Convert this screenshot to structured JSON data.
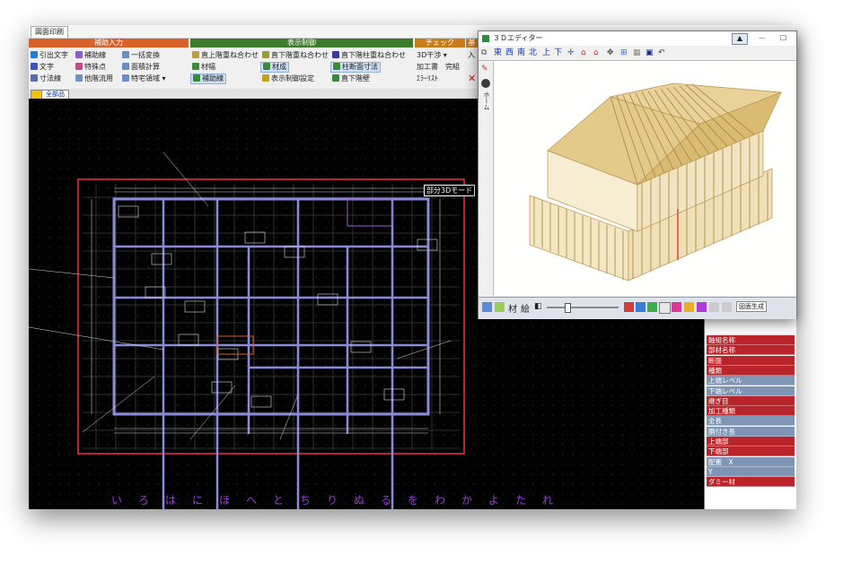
{
  "main": {
    "menu_tab": "図面印刷",
    "groups": [
      {
        "label": "補助入力",
        "color": "#d9622b"
      },
      {
        "label": "表示制御",
        "color": "#3d7c2d"
      },
      {
        "label": "チェック",
        "color": "#c97d1a"
      },
      {
        "label": "基",
        "color": "#c97d1a"
      }
    ],
    "ribbon": {
      "hikidashi": "引出文字",
      "hojosen": "補助線",
      "ikkatsu": "一括変換",
      "moji": "文字",
      "tokuten": "特殊点",
      "menseki": "面積計算",
      "sunpo": "寸法線",
      "kaisou": "他階流用",
      "tokuchi": "特宅領域",
      "ue_kasane": "直上階重ね合わせ",
      "shita_kasane": "直下階重ね合わせ",
      "shita_hashira": "直下階柱重ね合わせ",
      "zaihaba": "材幅",
      "zaimei": "材成",
      "hashira_sunpo": "柱断面寸法",
      "hojo": "補助線",
      "hyouji": "表示制御設定",
      "shita_kabe": "直下階壁",
      "btn_3d": "3D干渉",
      "kakou": "加工書",
      "kanryo": "完組",
      "error": "ｴﾗｰﾘｽﾄ",
      "iri": "入"
    },
    "tabs2": [
      "",
      "全部品"
    ],
    "canvas_labels": {
      "partial3d": "部分3Dモード"
    },
    "kana_row": [
      "い",
      "ろ",
      "は",
      "に",
      "ほ",
      "へ",
      "と",
      "ち",
      "り",
      "ぬ",
      "る",
      "を",
      "わ",
      "か",
      "よ",
      "た",
      "れ"
    ]
  },
  "properties": [
    {
      "label": "軸組名称",
      "color": "#b8242a"
    },
    {
      "label": "部材名称",
      "color": "#b8242a"
    },
    {
      "label": "断面",
      "color": "#b8242a"
    },
    {
      "label": "種類",
      "color": "#b8242a"
    },
    {
      "label": "上端レベル",
      "color": "#7f95b6"
    },
    {
      "label": "下端レベル",
      "color": "#7f95b6"
    },
    {
      "label": "継ぎ目",
      "color": "#b8242a"
    },
    {
      "label": "加工種類",
      "color": "#b8242a"
    },
    {
      "label": "全長",
      "color": "#7f95b6"
    },
    {
      "label": "胴付き長",
      "color": "#7f95b6"
    },
    {
      "label": "上端部",
      "color": "#b8242a"
    },
    {
      "label": "下端部",
      "color": "#b8242a"
    },
    {
      "label": "配置　X",
      "color": "#7f95b6"
    },
    {
      "label": "Y",
      "color": "#7f95b6"
    },
    {
      "label": "ダミー材",
      "color": "#b8242a"
    }
  ],
  "editor3d": {
    "title": "３Ｄエディター",
    "view_buttons": [
      "東",
      "西",
      "南",
      "北",
      "上",
      "下"
    ],
    "side_label": "ホーム",
    "bottom_labels": [
      "材",
      "絵"
    ],
    "bottom_right": "図面生成"
  }
}
